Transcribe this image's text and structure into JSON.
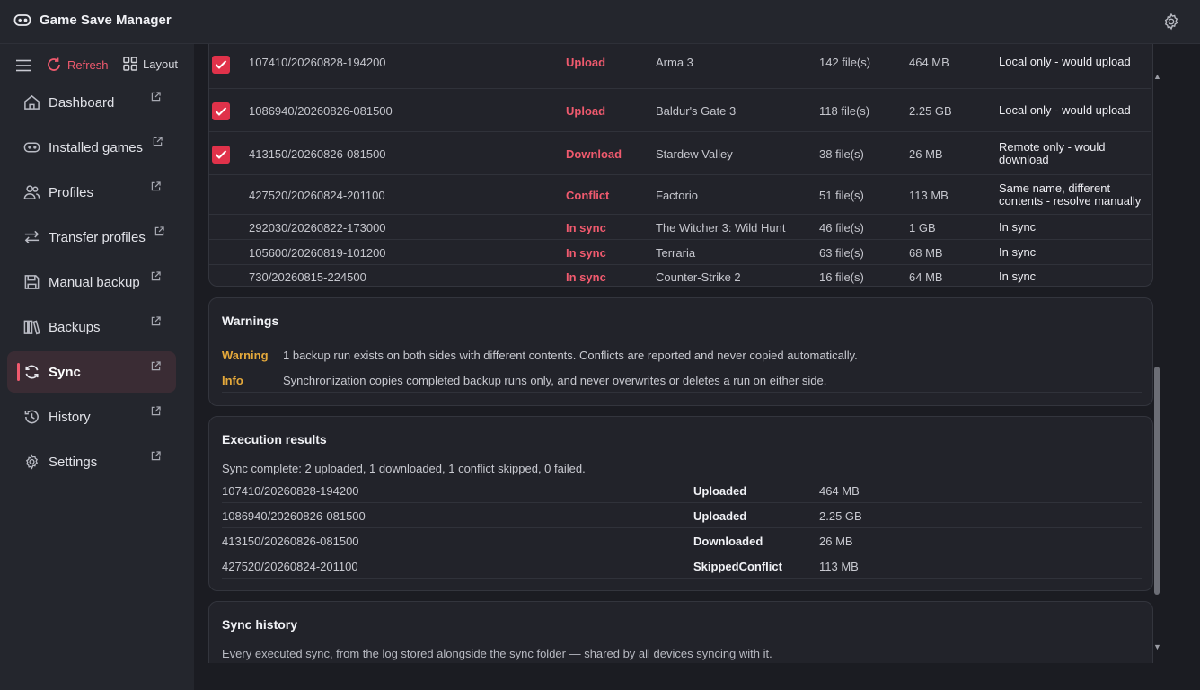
{
  "app": {
    "title": "Game Save Manager"
  },
  "toolbar": {
    "refresh_label": "Refresh",
    "layout_label": "Layout"
  },
  "sidebar": {
    "items": [
      {
        "label": "Dashboard",
        "icon": "home-icon"
      },
      {
        "label": "Installed games",
        "icon": "gamepad-icon"
      },
      {
        "label": "Profiles",
        "icon": "users-icon"
      },
      {
        "label": "Transfer profiles",
        "icon": "transfer-icon"
      },
      {
        "label": "Manual backup",
        "icon": "save-icon"
      },
      {
        "label": "Backups",
        "icon": "library-icon"
      },
      {
        "label": "Sync",
        "icon": "sync-icon",
        "active": true
      },
      {
        "label": "History",
        "icon": "history-icon"
      },
      {
        "label": "Settings",
        "icon": "gear-icon"
      }
    ]
  },
  "plan": {
    "rows": [
      {
        "checked": true,
        "run": "107410/20260828-194200",
        "action": "Upload",
        "game": "Arma 3",
        "files": "142 file(s)",
        "size": "464 MB",
        "status": "Local only - would upload"
      },
      {
        "checked": true,
        "run": "1086940/20260826-081500",
        "action": "Upload",
        "game": "Baldur's Gate 3",
        "files": "118 file(s)",
        "size": "2.25 GB",
        "status": "Local only - would upload"
      },
      {
        "checked": true,
        "run": "413150/20260826-081500",
        "action": "Download",
        "game": "Stardew Valley",
        "files": "38 file(s)",
        "size": "26 MB",
        "status": "Remote only - would download"
      },
      {
        "checked": false,
        "run": "427520/20260824-201100",
        "action": "Conflict",
        "game": "Factorio",
        "files": "51 file(s)",
        "size": "113 MB",
        "status": "Same name, different contents - resolve manually"
      },
      {
        "checked": false,
        "run": "292030/20260822-173000",
        "action": "In sync",
        "game": "The Witcher 3: Wild Hunt",
        "files": "46 file(s)",
        "size": "1 GB",
        "status": "In sync"
      },
      {
        "checked": false,
        "run": "105600/20260819-101200",
        "action": "In sync",
        "game": "Terraria",
        "files": "63 file(s)",
        "size": "68 MB",
        "status": "In sync"
      },
      {
        "checked": false,
        "run": "730/20260815-224500",
        "action": "In sync",
        "game": "Counter-Strike 2",
        "files": "16 file(s)",
        "size": "64 MB",
        "status": "In sync"
      }
    ]
  },
  "warnings": {
    "title": "Warnings",
    "items": [
      {
        "level": "Warning",
        "message": "1 backup run exists on both sides with different contents. Conflicts are reported and never copied automatically."
      },
      {
        "level": "Info",
        "message": "Synchronization copies completed backup runs only, and never overwrites or deletes a run on either side."
      }
    ]
  },
  "results": {
    "title": "Execution results",
    "summary": "Sync complete: 2 uploaded, 1 downloaded, 1 conflict skipped, 0 failed.",
    "rows": [
      {
        "run": "107410/20260828-194200",
        "status": "Uploaded",
        "size": "464 MB"
      },
      {
        "run": "1086940/20260826-081500",
        "status": "Uploaded",
        "size": "2.25 GB"
      },
      {
        "run": "413150/20260826-081500",
        "status": "Downloaded",
        "size": "26 MB"
      },
      {
        "run": "427520/20260824-201100",
        "status": "SkippedConflict",
        "size": "113 MB"
      }
    ]
  },
  "history": {
    "title": "Sync history",
    "description": "Every executed sync, from the log stored alongside the sync folder — shared by all devices syncing with it."
  },
  "colors": {
    "accent": "#f05a6e",
    "warning": "#e5a93b",
    "checkbox": "#e0324a"
  }
}
